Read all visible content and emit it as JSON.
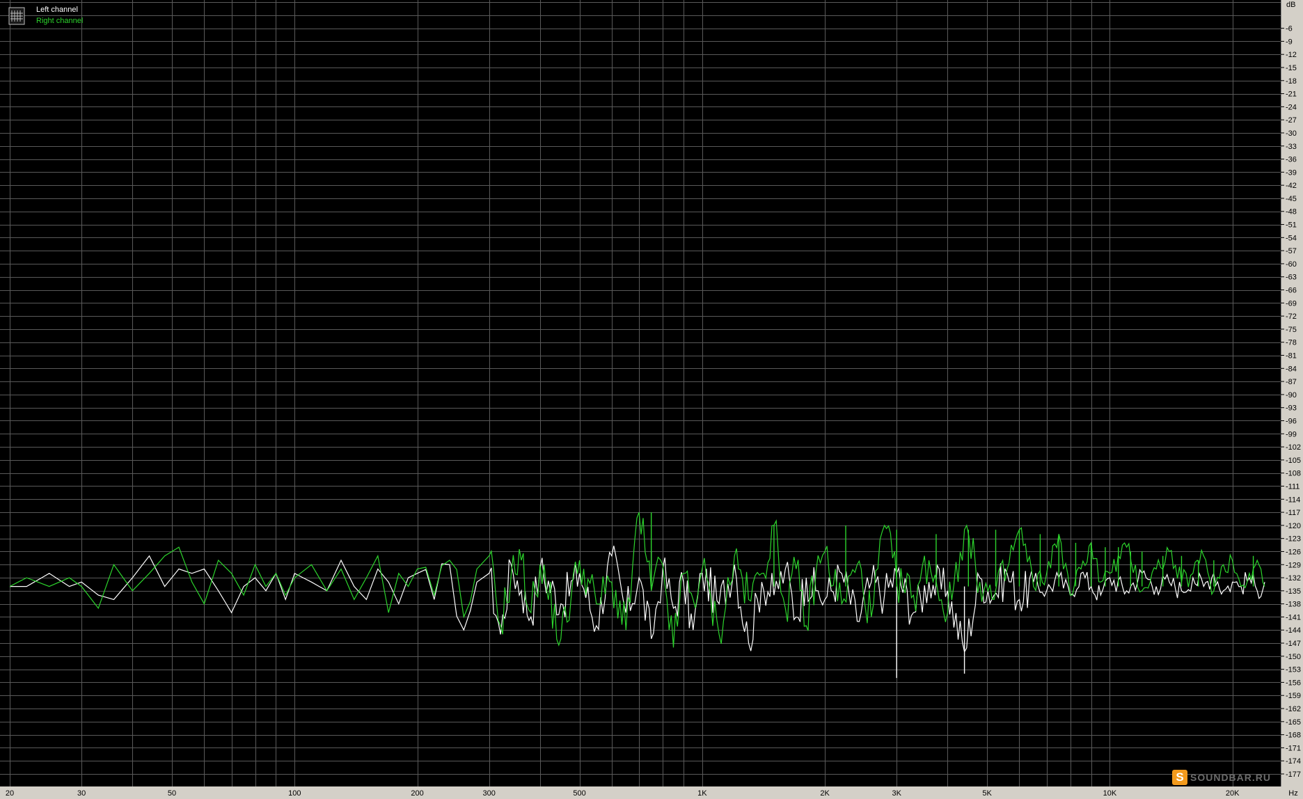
{
  "legend": {
    "items": [
      {
        "label": "Left channel",
        "color": "#ffffff"
      },
      {
        "label": "Right channel",
        "color": "#2cd42c"
      }
    ]
  },
  "watermark": {
    "text": "SOUNDBAR.RU"
  },
  "chart_data": {
    "type": "line",
    "title": "",
    "xlabel": "Hz",
    "ylabel": "dB",
    "x_scale": "log",
    "xlim": [
      20,
      24000
    ],
    "ylim": [
      -177,
      0
    ],
    "grid": true,
    "legend_position": "top-left",
    "x_tick_labels": [
      {
        "value": 20,
        "label": "20"
      },
      {
        "value": 30,
        "label": "30"
      },
      {
        "value": 50,
        "label": "50"
      },
      {
        "value": 100,
        "label": "100"
      },
      {
        "value": 200,
        "label": "200"
      },
      {
        "value": 300,
        "label": "300"
      },
      {
        "value": 500,
        "label": "500"
      },
      {
        "value": 1000,
        "label": "1K"
      },
      {
        "value": 2000,
        "label": "2K"
      },
      {
        "value": 3000,
        "label": "3K"
      },
      {
        "value": 5000,
        "label": "5K"
      },
      {
        "value": 10000,
        "label": "10K"
      },
      {
        "value": 20000,
        "label": "20K"
      }
    ],
    "y_ticks": [
      -6,
      -9,
      -12,
      -15,
      -18,
      -21,
      -24,
      -27,
      -30,
      -33,
      -36,
      -39,
      -42,
      -45,
      -48,
      -51,
      -54,
      -57,
      -60,
      -63,
      -66,
      -69,
      -72,
      -75,
      -78,
      -81,
      -84,
      -87,
      -90,
      -93,
      -96,
      -99,
      -102,
      -105,
      -108,
      -111,
      -114,
      -117,
      -120,
      -123,
      -126,
      -129,
      -132,
      -135,
      -138,
      -141,
      -144,
      -147,
      -150,
      -153,
      -156,
      -159,
      -162,
      -165,
      -168,
      -171,
      -174,
      -177
    ],
    "series": [
      {
        "name": "Left channel",
        "color": "#ffffff",
        "x": [
          20,
          22,
          25,
          28,
          30,
          33,
          36,
          40,
          44,
          48,
          52,
          56,
          60,
          65,
          70,
          75,
          80,
          85,
          90,
          95,
          100,
          110,
          120,
          130,
          140,
          150,
          160,
          170,
          180,
          190,
          200,
          220,
          240,
          260,
          280,
          300,
          320,
          340,
          360,
          380,
          400,
          450,
          500,
          550,
          600,
          650,
          700,
          750,
          800,
          850,
          900,
          950,
          1000,
          1100,
          1200,
          1300,
          1400,
          1500,
          1600,
          1700,
          1800,
          1900,
          2000,
          2200,
          2400,
          2600,
          2800,
          3000,
          3300,
          3600,
          4000,
          4400,
          4800,
          5200,
          5600,
          6000,
          6500,
          7000,
          7500,
          8000,
          8500,
          9000,
          9500,
          10000,
          11000,
          12000,
          13000,
          14000,
          15000,
          16000,
          17000,
          18000,
          19000,
          20000,
          21000,
          22000,
          23000,
          24000
        ],
        "y": [
          -134,
          -134,
          -131,
          -134,
          -133,
          -136,
          -137,
          -132,
          -127,
          -134,
          -130,
          -131,
          -130,
          -135,
          -140,
          -134,
          -132,
          -135,
          -131,
          -137,
          -131,
          -133,
          -135,
          -128,
          -134,
          -137,
          -130,
          -133,
          -138,
          -132,
          -131,
          -137,
          -129,
          -144,
          -133,
          -131,
          -145,
          -129,
          -135,
          -141,
          -130,
          -138,
          -131,
          -143,
          -127,
          -140,
          -132,
          -146,
          -130,
          -139,
          -133,
          -144,
          -131,
          -138,
          -129,
          -147,
          -133,
          -136,
          -130,
          -141,
          -132,
          -135,
          -137,
          -131,
          -142,
          -133,
          -136,
          -131,
          -140,
          -133,
          -135,
          -149,
          -132,
          -136,
          -131,
          -137,
          -133,
          -135,
          -132,
          -136,
          -131,
          -134,
          -136,
          -132,
          -135,
          -131,
          -134,
          -133,
          -135,
          -132,
          -134,
          -131,
          -135,
          -133,
          -134,
          -132,
          -135,
          -133
        ]
      },
      {
        "name": "Right channel",
        "color": "#2cd42c",
        "x": [
          20,
          22,
          25,
          28,
          30,
          33,
          36,
          40,
          44,
          48,
          52,
          56,
          60,
          65,
          70,
          75,
          80,
          85,
          90,
          95,
          100,
          110,
          120,
          130,
          140,
          150,
          160,
          170,
          180,
          190,
          200,
          220,
          240,
          260,
          280,
          300,
          320,
          340,
          360,
          380,
          400,
          450,
          500,
          550,
          600,
          650,
          700,
          750,
          800,
          850,
          900,
          950,
          1000,
          1100,
          1200,
          1300,
          1400,
          1500,
          1600,
          1700,
          1800,
          1900,
          2000,
          2200,
          2400,
          2600,
          2800,
          3000,
          3300,
          3600,
          4000,
          4400,
          4800,
          5200,
          5600,
          6000,
          6500,
          7000,
          7500,
          8000,
          8500,
          9000,
          9500,
          10000,
          11000,
          12000,
          13000,
          14000,
          15000,
          16000,
          17000,
          18000,
          19000,
          20000,
          21000,
          22000,
          23000,
          24000
        ],
        "y": [
          -134,
          -132,
          -134,
          -132,
          -134,
          -139,
          -129,
          -135,
          -131,
          -127,
          -125,
          -133,
          -138,
          -128,
          -131,
          -136,
          -129,
          -134,
          -131,
          -136,
          -132,
          -129,
          -135,
          -130,
          -137,
          -132,
          -127,
          -140,
          -131,
          -134,
          -130,
          -136,
          -128,
          -141,
          -130,
          -127,
          -143,
          -131,
          -128,
          -140,
          -129,
          -146,
          -128,
          -138,
          -133,
          -144,
          -117,
          -135,
          -129,
          -148,
          -131,
          -137,
          -130,
          -145,
          -127,
          -137,
          -131,
          -120,
          -139,
          -130,
          -143,
          -131,
          -126,
          -138,
          -129,
          -141,
          -120,
          -133,
          -136,
          -128,
          -140,
          -121,
          -133,
          -137,
          -130,
          -121,
          -134,
          -131,
          -122,
          -136,
          -130,
          -124,
          -133,
          -131,
          -125,
          -135,
          -130,
          -126,
          -133,
          -131,
          -127,
          -135,
          -129,
          -128,
          -134,
          -131,
          -128,
          -134
        ]
      }
    ],
    "peaks": {
      "Right channel": [
        {
          "x": 750,
          "y": -117
        },
        {
          "x": 1500,
          "y": -120
        },
        {
          "x": 2250,
          "y": -120
        },
        {
          "x": 3000,
          "y": -121
        },
        {
          "x": 3750,
          "y": -122
        },
        {
          "x": 4500,
          "y": -121
        },
        {
          "x": 5250,
          "y": -121
        },
        {
          "x": 6000,
          "y": -121
        },
        {
          "x": 6750,
          "y": -122
        },
        {
          "x": 7500,
          "y": -122
        },
        {
          "x": 8250,
          "y": -124
        },
        {
          "x": 9000,
          "y": -124
        },
        {
          "x": 9750,
          "y": -125
        },
        {
          "x": 10500,
          "y": -125
        },
        {
          "x": 11250,
          "y": -126
        },
        {
          "x": 12000,
          "y": -126
        },
        {
          "x": 13500,
          "y": -127
        },
        {
          "x": 15000,
          "y": -127
        },
        {
          "x": 16500,
          "y": -128
        },
        {
          "x": 18000,
          "y": -128
        },
        {
          "x": 22500,
          "y": -127
        }
      ],
      "Left channel": [
        {
          "x": 3000,
          "y": -155
        },
        {
          "x": 4400,
          "y": -154
        },
        {
          "x": 750,
          "y": -126
        },
        {
          "x": 1500,
          "y": -133
        }
      ]
    }
  }
}
